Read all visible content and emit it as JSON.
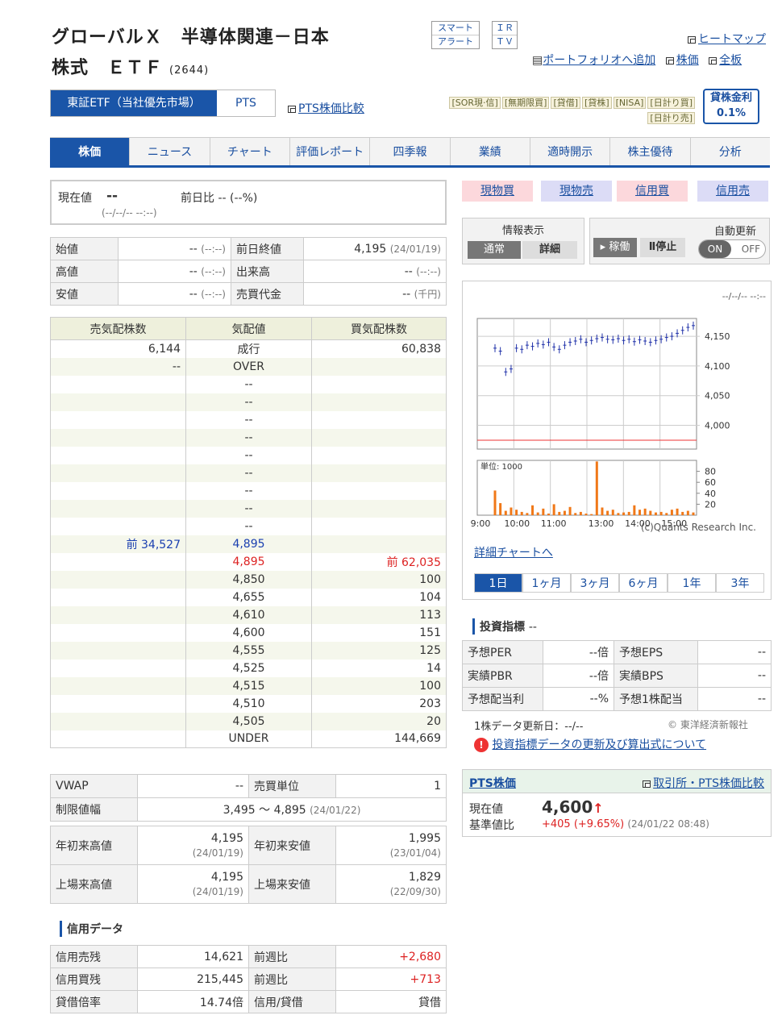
{
  "header": {
    "title_line1": "グローバルＸ　半導体関連－日本",
    "title_line2": "株式　ＥＴＦ",
    "code": "(2644)",
    "smart_alert_1": "スマート",
    "smart_alert_2": "アラート",
    "ir_1": "ＩＲ",
    "ir_2": "ＴＶ",
    "heatmap": "ヒートマップ",
    "portfolio": "ポートフォリオへ追加",
    "kabuka": "株価",
    "zenban": "全板"
  },
  "market": {
    "tab1": "東証ETF（当社優先市場）",
    "tab2": "PTS",
    "pts_compare": "PTS株価比較"
  },
  "tags": [
    "[SOR現·信]",
    "[無期限買]",
    "[貸借]",
    "[貸株]",
    "[NISA]",
    "[日計り買]",
    "[日計り売]"
  ],
  "lending": {
    "label": "貸株金利",
    "rate": "0.1%"
  },
  "nav": [
    "株価",
    "ニュース",
    "チャート",
    "評価レポート",
    "四季報",
    "業績",
    "適時開示",
    "株主優待",
    "分析"
  ],
  "current": {
    "label": "現在値",
    "value": "--",
    "change_label": "前日比",
    "change": "-- (--%)",
    "time": "(--/--/-- --:--)"
  },
  "prices": [
    {
      "l1": "始値",
      "v1": "--",
      "t1": "(--:--)",
      "l2": "前日終値",
      "v2": "4,195",
      "t2": "(24/01/19)"
    },
    {
      "l1": "高値",
      "v1": "--",
      "t1": "(--:--)",
      "l2": "出来高",
      "v2": "--",
      "t2": "(--:--)"
    },
    {
      "l1": "安値",
      "v1": "--",
      "t1": "(--:--)",
      "l2": "売買代金",
      "v2": "--",
      "t2": "(千円)"
    }
  ],
  "board": {
    "headers": [
      "売気配株数",
      "気配値",
      "買気配株数"
    ],
    "rows": [
      [
        "6,144",
        "成行",
        "60,838"
      ],
      [
        "--",
        "OVER",
        ""
      ],
      [
        "",
        "--",
        ""
      ],
      [
        "",
        "--",
        ""
      ],
      [
        "",
        "--",
        ""
      ],
      [
        "",
        "--",
        ""
      ],
      [
        "",
        "--",
        ""
      ],
      [
        "",
        "--",
        ""
      ],
      [
        "",
        "--",
        ""
      ],
      [
        "",
        "--",
        ""
      ],
      [
        "",
        "--",
        ""
      ],
      [
        "前 34,527",
        "4,895",
        ""
      ],
      [
        "",
        "4,895",
        "前 62,035"
      ],
      [
        "",
        "4,850",
        "100"
      ],
      [
        "",
        "4,655",
        "104"
      ],
      [
        "",
        "4,610",
        "113"
      ],
      [
        "",
        "4,600",
        "151"
      ],
      [
        "",
        "4,555",
        "125"
      ],
      [
        "",
        "4,525",
        "14"
      ],
      [
        "",
        "4,515",
        "100"
      ],
      [
        "",
        "4,510",
        "203"
      ],
      [
        "",
        "4,505",
        "20"
      ],
      [
        "",
        "UNDER",
        "144,669"
      ]
    ]
  },
  "vwap": {
    "label": "VWAP",
    "value": "--",
    "unit_label": "売買単位",
    "unit": "1",
    "limit_label": "制限値幅",
    "limit": "3,495 〜 4,895",
    "limit_date": "(24/01/22)"
  },
  "hilo": [
    {
      "l1": "年初来高値",
      "v1": "4,195",
      "d1": "(24/01/19)",
      "l2": "年初来安値",
      "v2": "1,995",
      "d2": "(23/01/04)"
    },
    {
      "l1": "上場来高値",
      "v1": "4,195",
      "d1": "(24/01/19)",
      "l2": "上場来安値",
      "v2": "1,829",
      "d2": "(22/09/30)"
    }
  ],
  "credit": {
    "title": "信用データ",
    "rows": [
      {
        "l1": "信用売残",
        "v1": "14,621",
        "l2": "前週比",
        "v2": "+2,680"
      },
      {
        "l1": "信用買残",
        "v1": "215,445",
        "l2": "前週比",
        "v2": "+713"
      },
      {
        "l1": "貸借倍率",
        "v1": "14.74倍",
        "l2": "信用/貸借",
        "v2": "貸借"
      }
    ]
  },
  "trade": [
    "現物買",
    "現物売",
    "信用買",
    "信用売"
  ],
  "info": {
    "label": "情報表示",
    "normal": "通常",
    "detail": "詳細",
    "auto_label": "自動更新",
    "run": "稼働",
    "stop": "停止",
    "on": "ON",
    "off": "OFF"
  },
  "chart": {
    "timestamp": "--/--/-- --:--",
    "yticks": [
      "4,150",
      "4,100",
      "4,050",
      "4,000"
    ],
    "vol_label": "単位: 1000",
    "vol_ticks": [
      "80",
      "60",
      "40",
      "20"
    ],
    "xticks": [
      "9:00",
      "10:00",
      "11:00",
      "13:00",
      "14:00",
      "15:00"
    ],
    "credit_text": "(c)Quants Research Inc.",
    "detail_link": "詳細チャートへ",
    "periods": [
      "1日",
      "1ヶ月",
      "3ヶ月",
      "6ヶ月",
      "1年",
      "3年"
    ]
  },
  "chart_data": {
    "type": "line",
    "title": "",
    "ylim": [
      3960,
      4180
    ],
    "series": [
      {
        "name": "",
        "values": [
          4130,
          4125,
          4090,
          4095,
          4130,
          4128,
          4135,
          4133,
          4138,
          4136,
          4140,
          4132,
          4128,
          4135,
          4140,
          4142,
          4145,
          4140,
          4143,
          4146,
          4148,
          4145,
          4144,
          4146,
          4143,
          4145,
          4141,
          4144,
          4142,
          4140,
          4143,
          4145,
          4148,
          4150,
          4155,
          4160,
          4165,
          4168
        ]
      }
    ],
    "volume": {
      "ylim": [
        0,
        100
      ],
      "values": [
        45,
        22,
        8,
        14,
        10,
        6,
        4,
        18,
        5,
        12,
        3,
        20,
        6,
        8,
        15,
        4,
        6,
        3,
        2,
        98,
        14,
        8,
        10,
        4,
        5,
        6,
        18,
        10,
        12,
        8,
        5,
        6,
        4,
        10,
        12,
        6,
        8,
        5
      ]
    }
  },
  "indicators": {
    "title": "投資指標",
    "suffix": "--",
    "rows": [
      {
        "l1": "予想PER",
        "v1": "--倍",
        "l2": "予想EPS",
        "v2": "--"
      },
      {
        "l1": "実績PBR",
        "v1": "--倍",
        "l2": "実績BPS",
        "v2": "--"
      },
      {
        "l1": "予想配当利",
        "v1": "--%",
        "l2": "予想1株配当",
        "v2": "--"
      }
    ],
    "update": "1株データ更新日：--/--",
    "copyright": "© 東洋経済新報社",
    "note_link": "投資指標データの更新及び算出式について"
  },
  "pts": {
    "title": "PTS株価",
    "compare": "取引所・PTS株価比較",
    "cur_label": "現在値",
    "cur": "4,600",
    "base_label": "基準値比",
    "change": "+405 (+9.65%)",
    "time": "(24/01/22 08:48)"
  },
  "colors": {
    "accent": "#1a55a8",
    "up": "#dd2222",
    "volume": "#f07818"
  }
}
